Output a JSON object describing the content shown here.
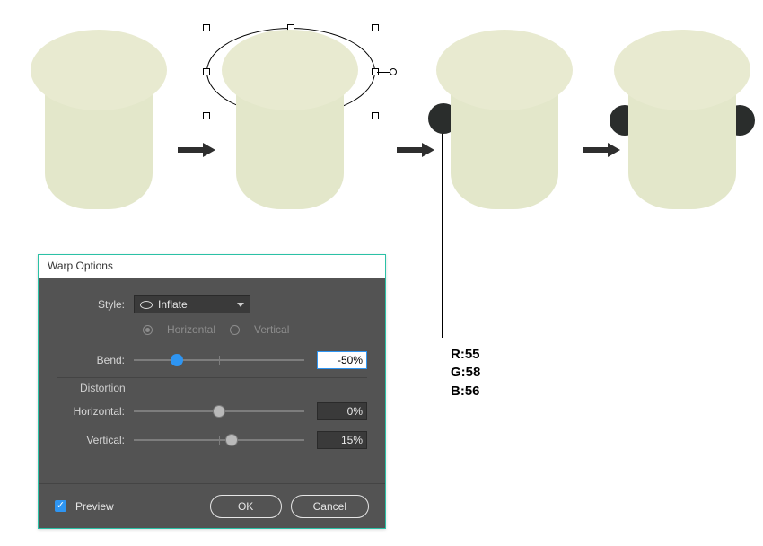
{
  "dialog": {
    "title": "Warp Options",
    "style_label": "Style:",
    "style_value": "Inflate",
    "horizontal_label": "Horizontal",
    "vertical_label": "Vertical",
    "bend_label": "Bend:",
    "bend_value": "-50%",
    "bend_pct": -50,
    "distortion_label": "Distortion",
    "h_dist_label": "Horizontal:",
    "h_dist_value": "0%",
    "h_dist_pct": 0,
    "v_dist_label": "Vertical:",
    "v_dist_value": "15%",
    "v_dist_pct": 15,
    "preview_label": "Preview",
    "ok_label": "OK",
    "cancel_label": "Cancel"
  },
  "callout": {
    "r": "R:55",
    "g": "G:58",
    "b": "B:56"
  },
  "colors": {
    "shape_cap": "#e8ead0",
    "shape_body": "#e3e7ca",
    "ear": "#2a2d2c",
    "accent_blue": "#2e95f2",
    "dialog_bg": "#535353",
    "dialog_border": "#2bc1a6"
  }
}
